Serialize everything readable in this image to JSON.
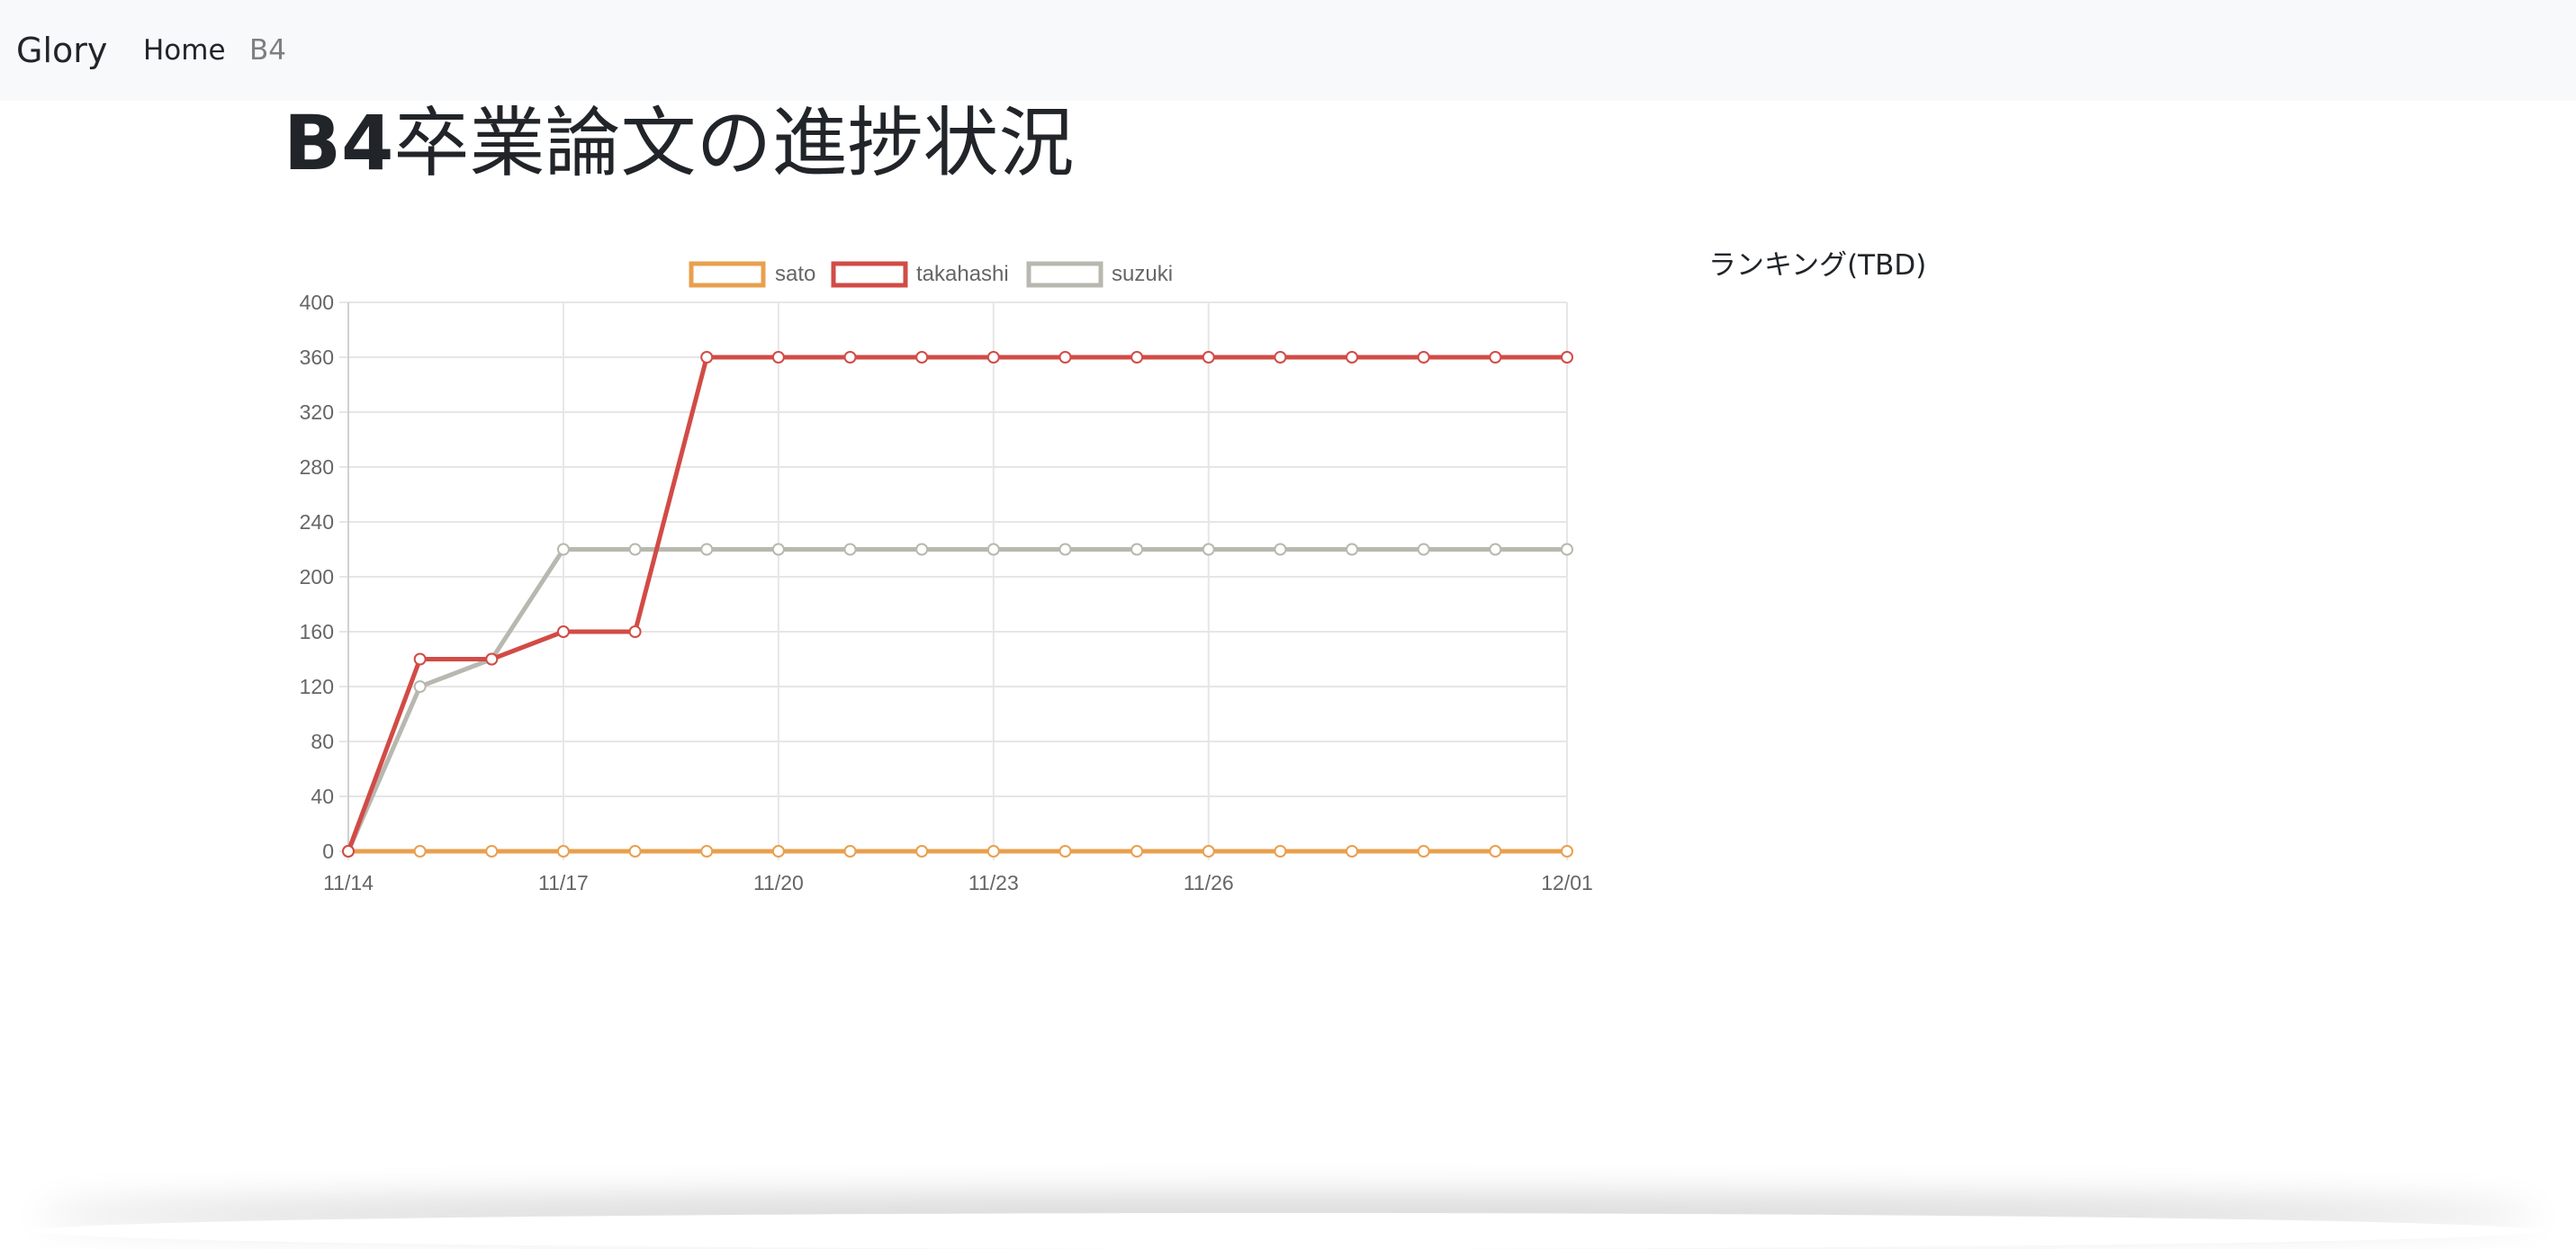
{
  "navbar": {
    "brand": "Glory",
    "links": [
      {
        "label": "Home",
        "active": true
      },
      {
        "label": "B4",
        "active": false
      }
    ]
  },
  "page": {
    "title_bold": "B4",
    "title_rest": "卒業論文の進捗状況",
    "ranking_label": "ランキング(TBD)"
  },
  "chart_data": {
    "type": "line",
    "x_labels": [
      "11/14",
      "11/15",
      "11/16",
      "11/17",
      "11/18",
      "11/19",
      "11/20",
      "11/21",
      "11/22",
      "11/23",
      "11/24",
      "11/25",
      "11/26",
      "11/27",
      "11/28",
      "11/29",
      "11/30",
      "12/01"
    ],
    "x_tick_labels": [
      "11/14",
      "11/17",
      "11/20",
      "11/23",
      "11/26",
      "12/01"
    ],
    "ylim": [
      0,
      400
    ],
    "y_ticks": [
      0,
      40,
      80,
      120,
      160,
      200,
      240,
      280,
      320,
      360,
      400
    ],
    "grid": true,
    "legend_position": "top",
    "series": [
      {
        "name": "sato",
        "color": "#e8a04e",
        "values": [
          0,
          0,
          0,
          0,
          0,
          0,
          0,
          0,
          0,
          0,
          0,
          0,
          0,
          0,
          0,
          0,
          0,
          0
        ]
      },
      {
        "name": "takahashi",
        "color": "#d24b46",
        "values": [
          0,
          140,
          140,
          160,
          160,
          360,
          360,
          360,
          360,
          360,
          360,
          360,
          360,
          360,
          360,
          360,
          360,
          360
        ]
      },
      {
        "name": "suzuki",
        "color": "#b8b8b0",
        "values": [
          0,
          120,
          140,
          220,
          220,
          220,
          220,
          220,
          220,
          220,
          220,
          220,
          220,
          220,
          220,
          220,
          220,
          220
        ]
      }
    ]
  }
}
